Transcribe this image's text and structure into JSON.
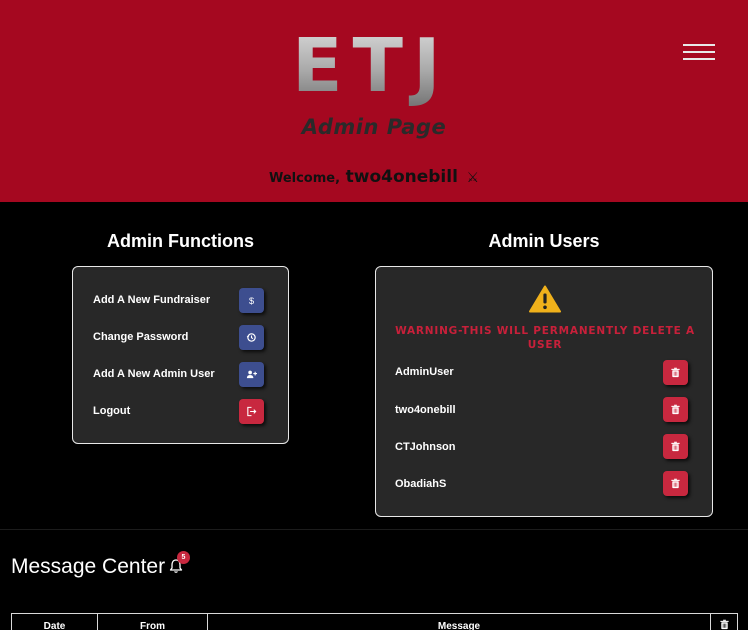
{
  "header": {
    "logo_text": "ETJ",
    "subtitle": "Admin Page",
    "welcome_label": "Welcome,",
    "username": "two4onebill",
    "user_icon": "swords-icon",
    "menu_icon": "hamburger-icon",
    "background_color": "#a50820"
  },
  "admin_functions": {
    "title": "Admin Functions",
    "items": [
      {
        "label": "Add A New Fundraiser",
        "icon": "dollar-icon",
        "color": "#3d4e8f"
      },
      {
        "label": "Change Password",
        "icon": "history-icon",
        "color": "#3d4e8f"
      },
      {
        "label": "Add A New Admin User",
        "icon": "user-plus-icon",
        "color": "#3d4e8f"
      },
      {
        "label": "Logout",
        "icon": "logout-icon",
        "color": "#c8283f"
      }
    ]
  },
  "admin_users": {
    "title": "Admin Users",
    "warning_icon": "warning-icon",
    "warning": "WARNING-THIS WILL PERMANENTLY DELETE A USER",
    "users": [
      "AdminUser",
      "two4onebill",
      "CTJohnson",
      "ObadiahS"
    ],
    "delete_icon": "trash-icon"
  },
  "message_center": {
    "title": "Message Center",
    "notification_icon": "bell-icon",
    "badge_count": "5",
    "columns": [
      "Date",
      "From",
      "Message"
    ],
    "delete_column_icon": "trash-icon"
  }
}
